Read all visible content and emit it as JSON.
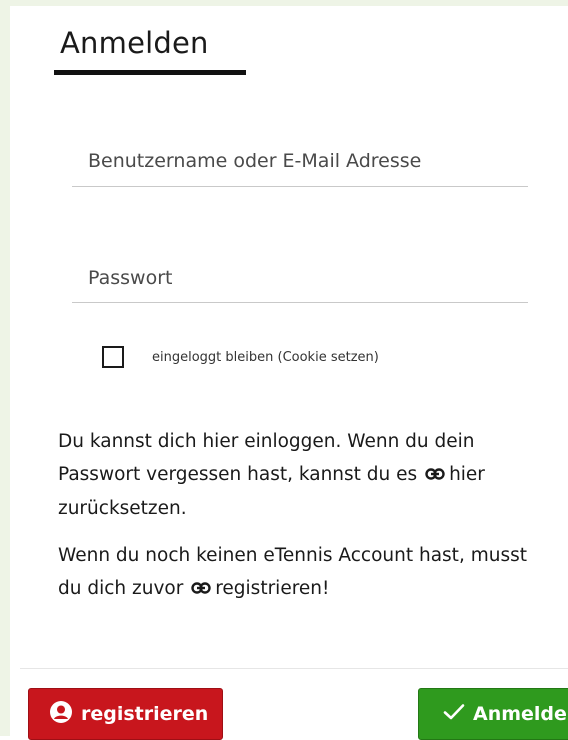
{
  "form": {
    "title": "Anmelden",
    "username_placeholder": "Benutzername oder E-Mail Adresse",
    "password_placeholder": "Passwort",
    "remember_label": "eingeloggt bleiben (Cookie setzen)",
    "remember_checked": false
  },
  "info": {
    "para1_before": "Du kannst dich hier einloggen. Wenn du dein Passwort vergessen hast, kannst du es",
    "para1_link": "hier",
    "para1_after": "zurücksetzen.",
    "para2_before": "Wenn du noch keinen eTennis Account hast, musst du dich zuvor",
    "para2_link": "registrieren!"
  },
  "buttons": {
    "register_label": "registrieren",
    "login_label": "Anmelden"
  },
  "icons": {
    "link": "link-icon",
    "register": "user-circle-icon",
    "login": "checkmark-icon"
  },
  "colors": {
    "register_bg": "#c8161d",
    "login_bg": "#2f9a1e"
  }
}
